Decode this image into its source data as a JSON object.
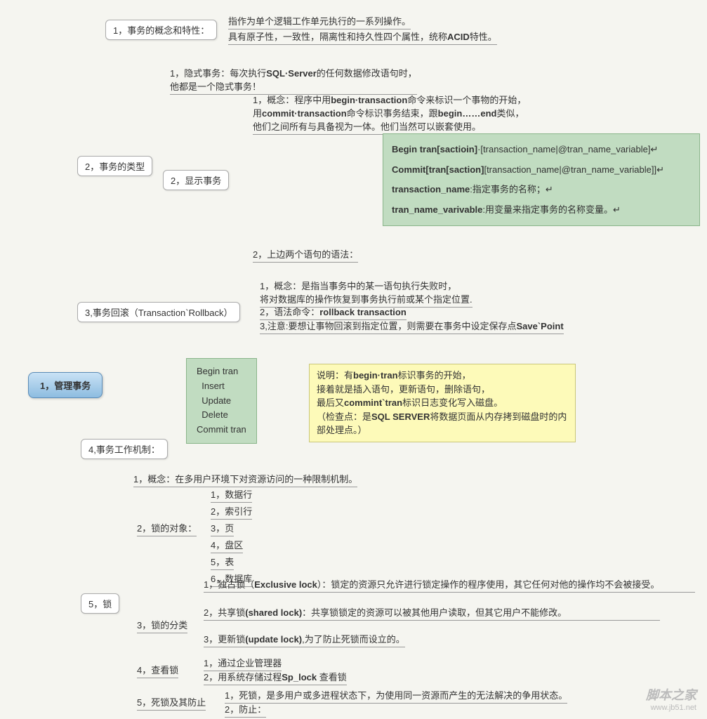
{
  "root": "1，管理事务",
  "n1": {
    "label": "1，事务的概念和特性：",
    "t1": "指作为单个逻辑工作单元执行的一系列操作。",
    "t2_a": "具有原子性，一致性，隔离性和持久性四个属性，统称",
    "t2_b": "ACID",
    "t2_c": "特性。"
  },
  "n2": {
    "label": "2，事务的类型",
    "implicit_a": "1，隐式事务：每次执行",
    "implicit_b": "SQL·Server",
    "implicit_c": "的任何数据修改语句时，",
    "implicit_d": "他都是一个隐式事务！",
    "exp_label": "2，显示事务",
    "exp_concept_a": "1，概念：程序中用",
    "exp_concept_b": "begin·transaction",
    "exp_concept_c": "命令来标识一个事物的开始，",
    "exp_concept_d": "用",
    "exp_concept_e": "commit·transaction",
    "exp_concept_f": "命令标识事务结束，跟",
    "exp_concept_g": "begin……end",
    "exp_concept_h": "类似，",
    "exp_concept_i": "他们之间所有与具备视为一体。他们当然可以嵌套使用。",
    "syn_label": "2，上边两个语句的语法：",
    "syn1_a": "Begin tran[sactioin]",
    "syn1_b": "·[transaction_name|@tran_name_variable]↵",
    "syn2_a": "Commit[tran[saction]",
    "syn2_b": "[transaction_name|@tran_name_variable]]↵",
    "syn3_a": "transaction_name",
    "syn3_b": ":指定事务的名称；↵",
    "syn4_a": "tran_name_varivable",
    "syn4_b": ":用变量来指定事务的名称变量。↵"
  },
  "n3": {
    "label": "3,事务回滚（Transaction`Rollback）",
    "t1": "1，概念：是指当事务中的某一语句执行失败时，",
    "t2": "将对数据库的操作恢复到事务执行前或某个指定位置.",
    "t3_a": "2，语法命令：",
    "t3_b": "rollback  transaction",
    "t4_a": "3,注意:要想让事物回滚到指定位置，则需要在事务中设定保存点",
    "t4_b": "Save`Point"
  },
  "n4": {
    "label": "4,事务工作机制：",
    "code": "Begin tran\n  Insert\n  Update\n  Delete\nCommit tran",
    "y1_a": "说明：有",
    "y1_b": "begin·tran",
    "y1_c": "标识事务的开始，",
    "y2": "接着就是插入语句，更新语句，删除语句，",
    "y3_a": "最后又",
    "y3_b": "commint`tran",
    "y3_c": "标识日志变化写入磁盘。",
    "y4_a": "（检查点：是",
    "y4_b": "SQL SERVER",
    "y4_c": "将数据页面从内存拷到磁盘时的内部处理点。）"
  },
  "n5": {
    "label": "5，锁",
    "concept": "1，概念：在多用户环境下对资源访问的一种限制机制。",
    "obj_label": "2，锁的对象：",
    "o1": "1，数据行",
    "o2": "2，索引行",
    "o3": "3，页",
    "o4": "4，盘区",
    "o5": "5，表",
    "o6": "6，数据库",
    "cat_label": "3，锁的分类",
    "c1_a": "1，独占锁（",
    "c1_b": "Exclusive lock",
    "c1_c": "）：锁定的资源只允许进行锁定操作的程序使用，其它任何对他的操作均不会被接受。",
    "c2_a": "2，共享锁",
    "c2_b": "(shared lock)",
    "c2_c": "：共享锁锁定的资源可以被其他用户读取，但其它用户不能修改。",
    "c3_a": "3，更新锁",
    "c3_b": "(update lock)",
    "c3_c": ",为了防止死锁而设立的。",
    "view_label": "4，查看锁",
    "v1": "1，通过企业管理器",
    "v2_a": "2，用系统存储过程",
    "v2_b": "Sp_lock",
    "v2_c": " 查看锁",
    "dead_label": "5，死锁及其防止",
    "d1": "1，死锁，是多用户或多进程状态下，为使用同一资源而产生的无法解决的争用状态。",
    "d2": "2，防止："
  },
  "wm1": "脚本之家",
  "wm2": "www.jb51.net"
}
